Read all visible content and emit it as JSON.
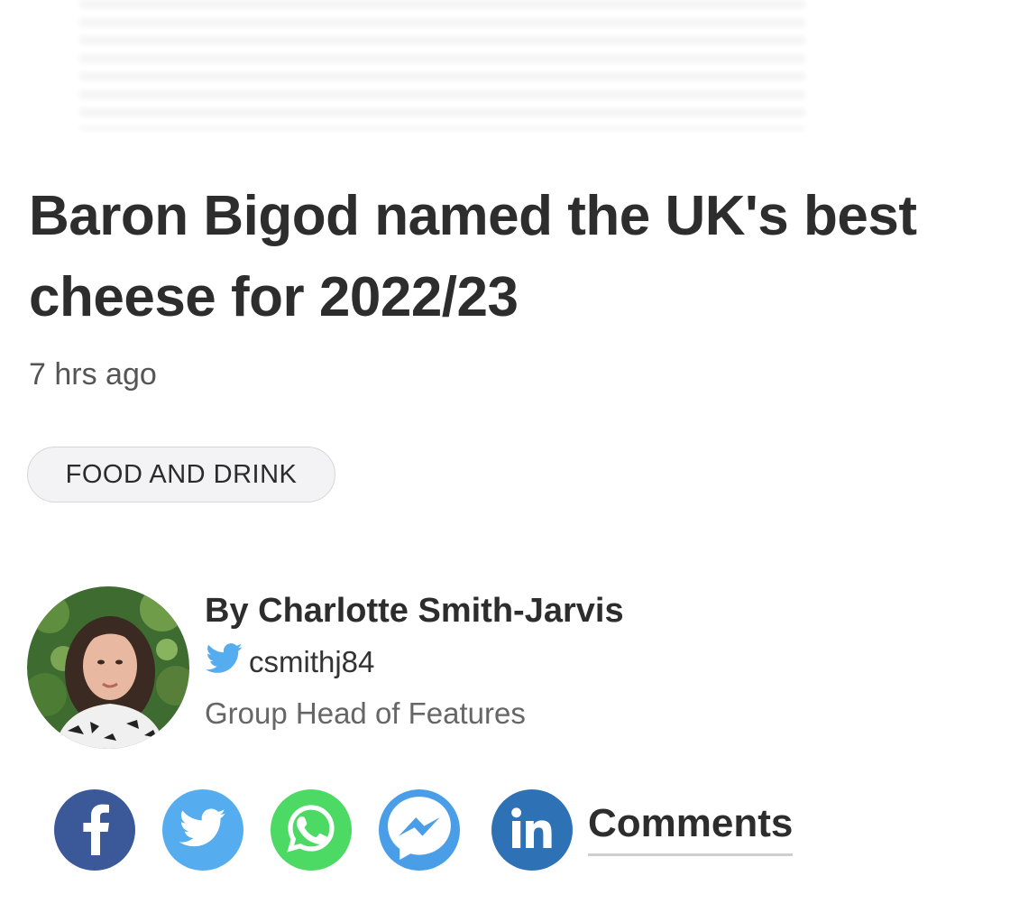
{
  "article": {
    "headline": "Baron Bigod named the UK's best cheese for 2022/23",
    "timestamp": "7 hrs ago",
    "tag": "FOOD AND DRINK"
  },
  "author": {
    "byline": "By Charlotte Smith-Jarvis",
    "twitter_handle": "csmithj84",
    "role": "Group Head of Features"
  },
  "share": {
    "facebook_color": "#3b5998",
    "twitter_color": "#55acee",
    "whatsapp_color": "#4cd964",
    "messenger_color": "#4a9ee8",
    "linkedin_color": "#2f71b5",
    "comments_label": "Comments"
  }
}
